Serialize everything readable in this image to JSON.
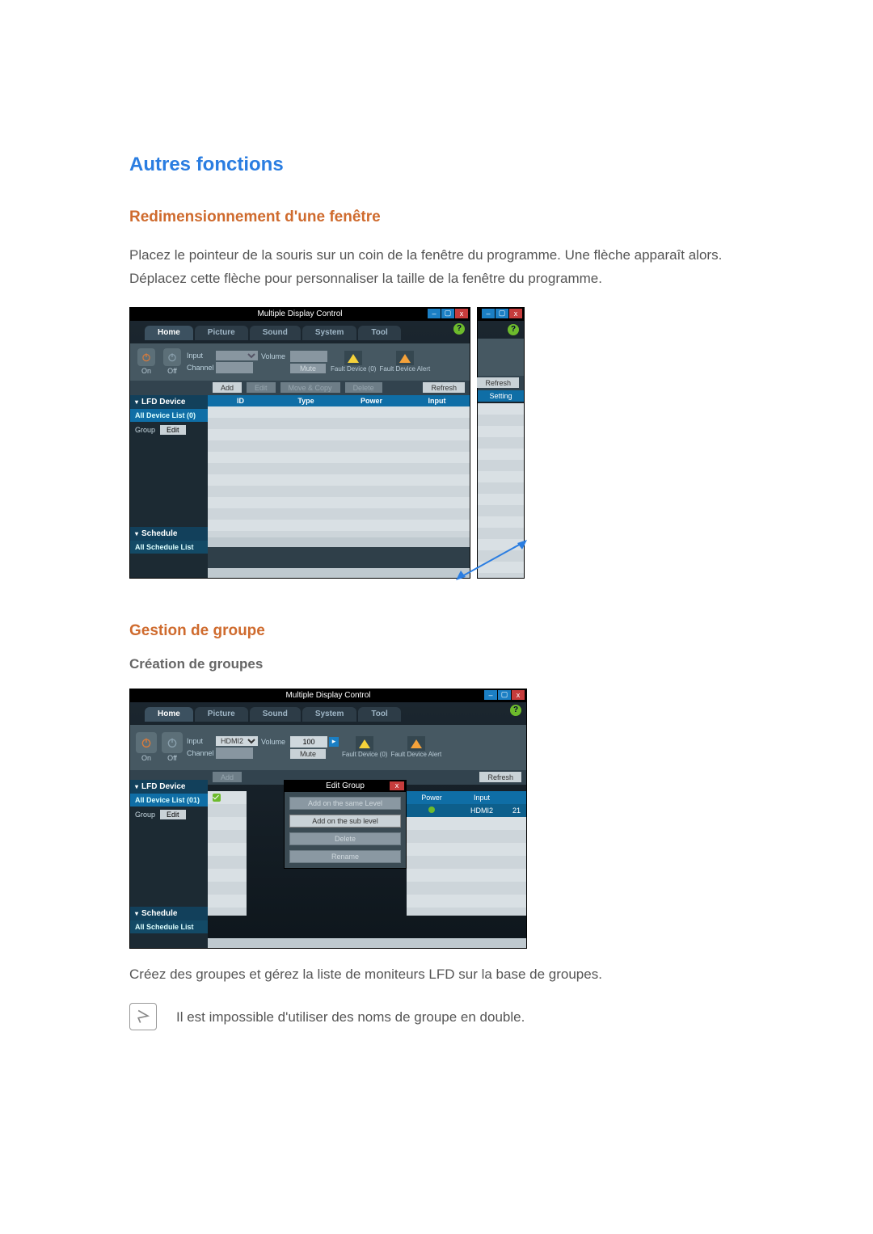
{
  "headings": {
    "h1": "Autres fonctions",
    "h2": "Redimensionnement d'une fenêtre",
    "h3": "Gestion de groupe",
    "h4": "Création de groupes"
  },
  "paragraphs": {
    "p1": "Placez le pointeur de la souris sur un coin de la fenêtre du programme. Une flèche apparaît alors. Déplacez cette flèche pour personnaliser la taille de la fenêtre du programme.",
    "p2": "Créez des groupes et gérez la liste de moniteurs LFD sur la base de groupes.",
    "note": "Il est impossible d'utiliser des noms de groupe en double."
  },
  "app": {
    "title": "Multiple Display Control",
    "tabs": {
      "home": "Home",
      "picture": "Picture",
      "sound": "Sound",
      "system": "System",
      "tool": "Tool"
    },
    "power": {
      "on": "On",
      "off": "Off"
    },
    "labels": {
      "input": "Input",
      "channel": "Channel",
      "volume": "Volume",
      "mute": "Mute"
    },
    "alerts": {
      "fault0": "Fault Device (0)",
      "alert": "Fault Device Alert"
    },
    "buttons": {
      "add": "Add",
      "edit": "Edit",
      "move": "Move & Copy",
      "delete": "Delete",
      "refresh": "Refresh"
    },
    "cols": {
      "id": "ID",
      "type": "Type",
      "power": "Power",
      "input": "Input",
      "setting": "Setting"
    },
    "side": {
      "lfd": "LFD Device",
      "all0": "All Device List (0)",
      "all1": "All Device List (01)",
      "group": "Group",
      "edit": "Edit",
      "schedule": "Schedule",
      "allSched": "All Schedule List"
    }
  },
  "app2": {
    "input_value": "HDMI2",
    "volume_value": "100",
    "cols": {
      "power": "Power",
      "input": "Input"
    },
    "row": {
      "input": "HDMI2",
      "num": "21"
    },
    "popup": {
      "title": "Edit Group",
      "same": "Add on the same Level",
      "sub": "Add on the sub level",
      "delete": "Delete",
      "rename": "Rename"
    }
  }
}
